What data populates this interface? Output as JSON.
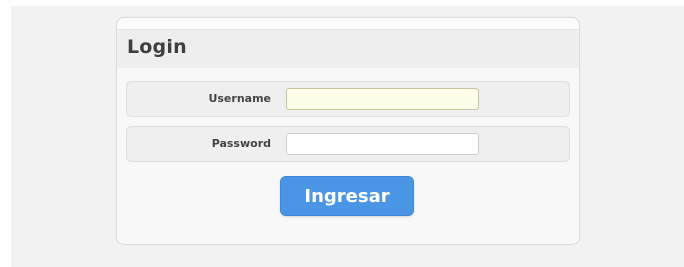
{
  "login": {
    "title": "Login",
    "username_label": "Username",
    "username_value": "",
    "password_label": "Password",
    "password_value": "",
    "submit_label": "Ingresar"
  },
  "colors": {
    "background": "#f2f2f2",
    "panel": "#f8f8f8",
    "username_field_bg": "#fdfde9",
    "button": "#4a96e4"
  }
}
